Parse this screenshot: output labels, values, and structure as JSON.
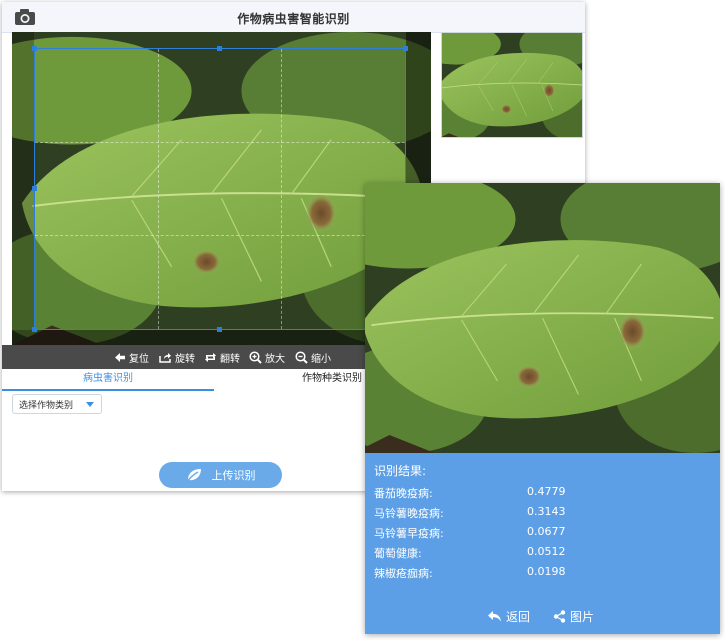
{
  "main": {
    "title": "作物病虫害智能识别",
    "toolbar": {
      "reset": "复位",
      "rotate": "旋转",
      "flip": "翻转",
      "zoom_in": "放大",
      "zoom_out": "缩小"
    },
    "tabs": {
      "disease": "病虫害识别",
      "crop": "作物种类识别"
    },
    "select": {
      "value": "选择作物类别"
    },
    "upload_label": "上传识别"
  },
  "result": {
    "title": "识别结果:",
    "items": [
      {
        "name": "番茄晚疫病:",
        "score": "0.4779"
      },
      {
        "name": "马铃薯晚疫病:",
        "score": "0.3143"
      },
      {
        "name": "马铃薯早疫病:",
        "score": "0.0677"
      },
      {
        "name": "葡萄健康:",
        "score": "0.0512"
      },
      {
        "name": "辣椒疮痂病:",
        "score": "0.0198"
      }
    ],
    "back_label": "返回",
    "share_label": "图片"
  },
  "icons": {
    "camera": "camera-icon",
    "reset": "arrow-left-icon",
    "rotate": "share-out-icon",
    "flip": "repeat-icon",
    "zoom_in": "zoom-in-icon",
    "zoom_out": "zoom-out-icon",
    "upload": "leaf-icon",
    "back": "reply-icon",
    "share": "share-nodes-icon"
  },
  "colors": {
    "accent": "#3b8fe0",
    "result_bg": "#5d9fe6",
    "upload_bg": "#6aaae8",
    "toolbar_bg": "#4a4a4a"
  }
}
